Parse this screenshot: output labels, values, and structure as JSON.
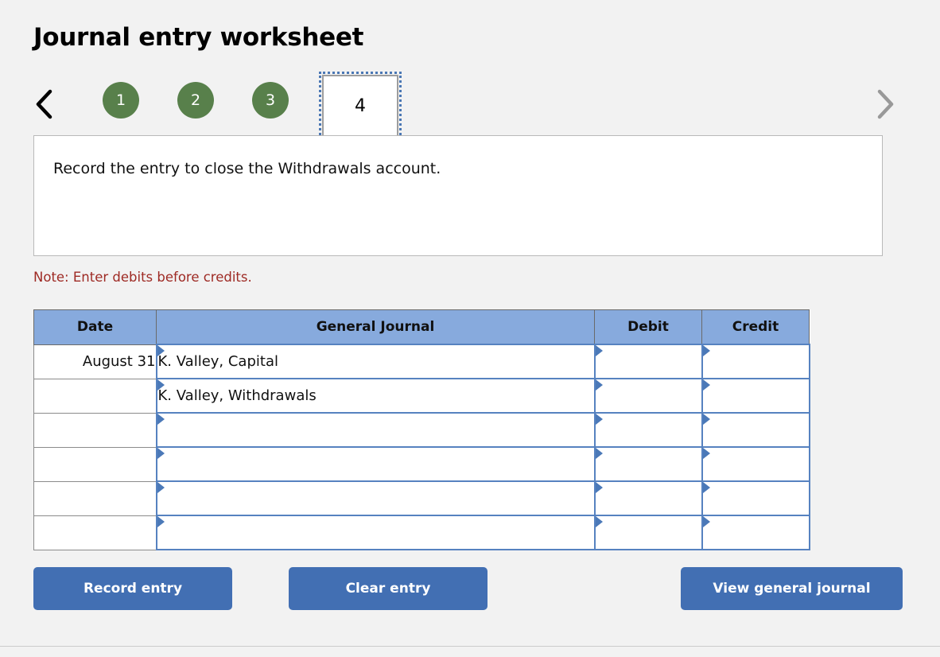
{
  "page": {
    "title": "Journal entry worksheet",
    "background_color": "#f2f2f2"
  },
  "step_nav": {
    "prev_icon": "chevron-left-icon",
    "next_icon": "chevron-right-icon",
    "completed_color": "#58804b",
    "active_outline_color": "#4a77b4",
    "steps": [
      {
        "label": "1",
        "state": "completed"
      },
      {
        "label": "2",
        "state": "completed"
      },
      {
        "label": "3",
        "state": "completed"
      },
      {
        "label": "4",
        "state": "active"
      }
    ]
  },
  "instruction": {
    "text": "Record the entry to close the Withdrawals account."
  },
  "note": {
    "text": "Note: Enter debits before credits.",
    "color": "#9e2a24"
  },
  "journal_table": {
    "header_color": "#87aadd",
    "columns": [
      "Date",
      "General Journal",
      "Debit",
      "Credit"
    ],
    "rows": [
      {
        "date": "August 31",
        "general_journal": "K. Valley, Capital",
        "debit": "",
        "credit": ""
      },
      {
        "date": "",
        "general_journal": "K. Valley, Withdrawals",
        "debit": "",
        "credit": ""
      },
      {
        "date": "",
        "general_journal": "",
        "debit": "",
        "credit": ""
      },
      {
        "date": "",
        "general_journal": "",
        "debit": "",
        "credit": ""
      },
      {
        "date": "",
        "general_journal": "",
        "debit": "",
        "credit": ""
      },
      {
        "date": "",
        "general_journal": "",
        "debit": "",
        "credit": ""
      }
    ]
  },
  "buttons": {
    "record": "Record entry",
    "clear": "Clear entry",
    "view": "View general journal",
    "color": "#426fb3"
  }
}
